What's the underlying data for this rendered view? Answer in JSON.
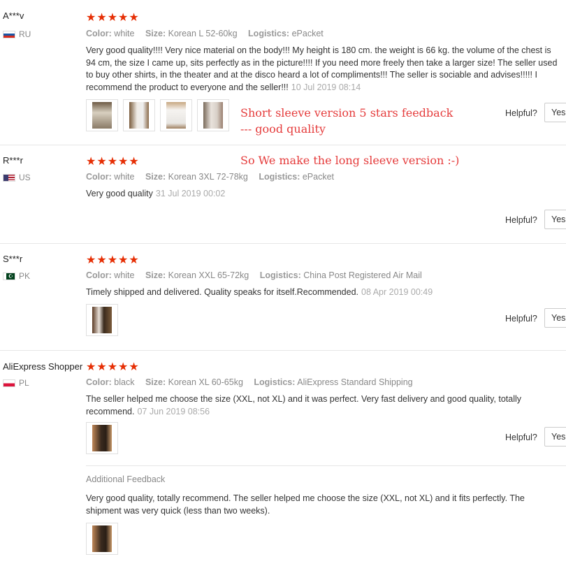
{
  "labels": {
    "color": "Color:",
    "size": "Size:",
    "logistics": "Logistics:",
    "helpful": "Helpful?",
    "yes": "Yes",
    "additional_feedback": "Additional Feedback"
  },
  "stars_display": "★★★★★",
  "annotations": {
    "note1_line1": "Short sleeve version 5 stars feedback",
    "note1_line2": "--- good quality",
    "note2": "So We make the long sleeve version :-)"
  },
  "reviews": [
    {
      "user": "A***v",
      "country": "RU",
      "rating": 5,
      "color": "white",
      "size": "Korean L 52-60kg",
      "logistics": "ePacket",
      "text": "Very good quality!!!! Very nice material on the body!!! My height is 180 cm. the weight is 66 kg. the volume of the chest is 94 cm, the size I came up, sits perfectly as in the picture!!!! If you need more freely then take a larger size! The seller used to buy other shirts, in the theater and at the disco heard a lot of compliments!!! The seller is sociable and advises!!!!! I recommend the product to everyone and the seller!!!",
      "date": "10 Jul 2019 08:14"
    },
    {
      "user": "R***r",
      "country": "US",
      "rating": 5,
      "color": "white",
      "size": "Korean 3XL 72-78kg",
      "logistics": "ePacket",
      "text": "Very good quality",
      "date": "31 Jul 2019 00:02"
    },
    {
      "user": "S***r",
      "country": "PK",
      "rating": 5,
      "color": "white",
      "size": "Korean XXL 65-72kg",
      "logistics": "China Post Registered Air Mail",
      "text": "Timely shipped and delivered. Quality speaks for itself.Recommended.",
      "date": "08 Apr 2019 00:49"
    },
    {
      "user": "AliExpress Shopper",
      "country": "PL",
      "rating": 5,
      "color": "black",
      "size": "Korean XL 60-65kg",
      "logistics": "AliExpress Standard Shipping",
      "text": "The seller helped me choose the size (XXL, not XL) and it was perfect. Very fast delivery and good quality, totally recommend.",
      "date": "07 Jun 2019 08:56",
      "additional_text": "Very good quality, totally recommend. The seller helped me choose the size (XXL, not XL) and it fits perfectly. The shipment was very quick (less than two weeks)."
    }
  ],
  "colors": {
    "star": "#e62e04",
    "annotation": "#e53b3b",
    "flag_ru": [
      "#ffffff",
      "#1c57a5",
      "#d52b1e"
    ],
    "flag_pl": [
      "#ffffff",
      "#dc143c"
    ],
    "flag_pk": "#01411c"
  }
}
